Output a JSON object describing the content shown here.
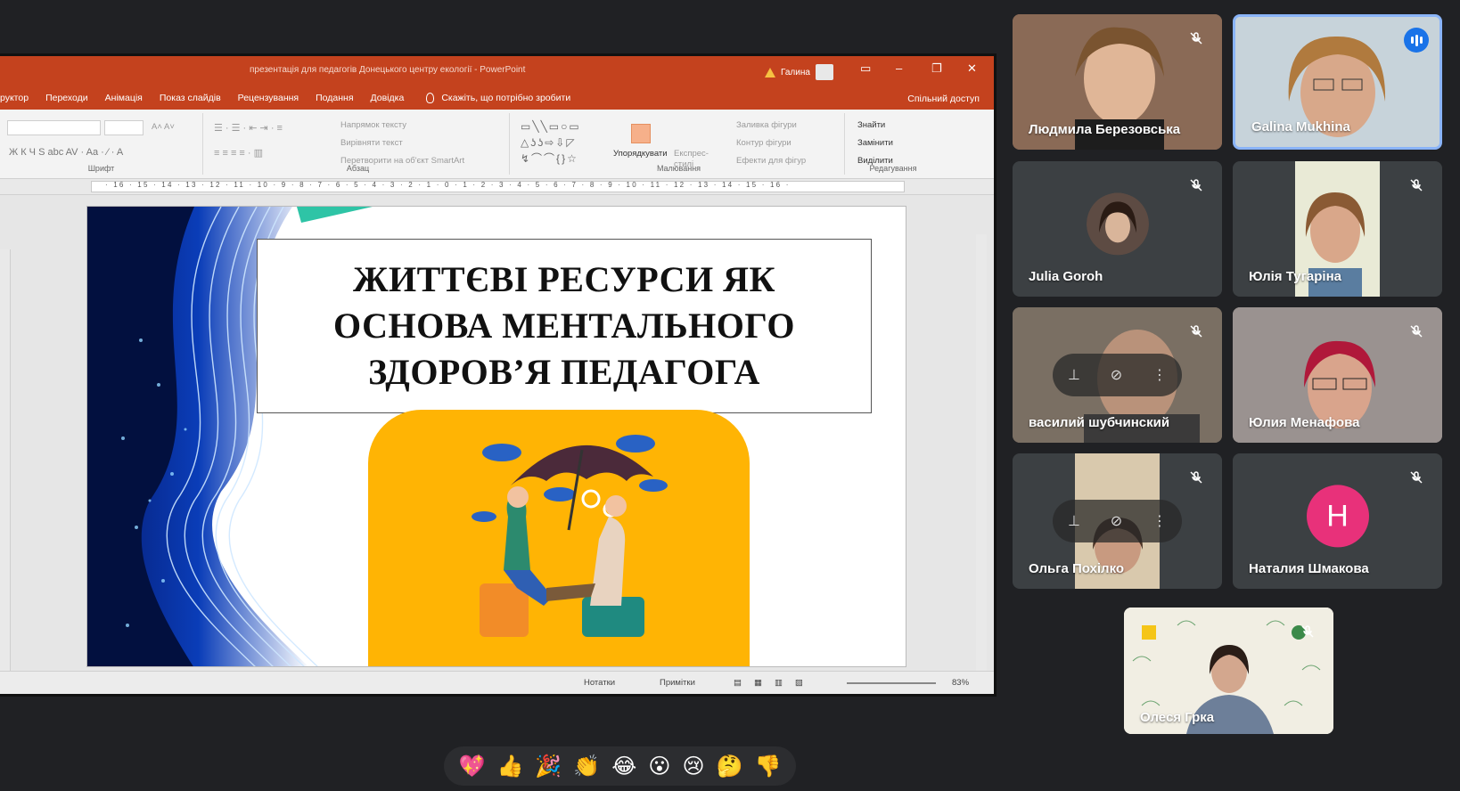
{
  "ppt": {
    "doc_title": "презентація для педагогів Донецького центру екології  -  PowerPoint",
    "user_name": "Галина",
    "tabs": [
      "руктор",
      "Переходи",
      "Анімація",
      "Показ слайдів",
      "Рецензування",
      "Подання",
      "Довідка"
    ],
    "tell_me": "Скажіть, що потрібно зробити",
    "share": "Спільний доступ",
    "ribbon": {
      "font_group": "Шрифт",
      "paragraph_group": "Абзац",
      "drawing_group": "Малювання",
      "editing_group": "Редагування",
      "text_direction": "Напрямок тексту",
      "align_text": "Вирівняти текст",
      "smartart": "Перетворити на об'єкт SmartArt",
      "arrange": "Упорядкувати",
      "quick_styles": "Експрес-стилі",
      "shape_fill": "Заливка фігури",
      "shape_outline": "Контур фігури",
      "shape_effects": "Ефекти для фігур",
      "find": "Знайти",
      "replace": "Замінити",
      "select": "Виділити"
    },
    "ruler_ticks": "· 16 · 15 · 14 · 13 · 12 · 11 · 10 · 9 · 8 · 7 · 6 · 5 · 4 · 3 · 2 · 1 · 0 · 1 · 2 · 3 · 4 · 5 · 6 · 7 · 8 · 9 · 10 · 11 · 12 · 13 · 14 · 15 · 16 ·",
    "slide": {
      "title_line1": "ЖИТТЄВІ РЕСУРСИ ЯК",
      "title_line2": "ОСНОВА МЕНТАЛЬНОГО",
      "title_line3": "ЗДОРОВ’Я ПЕДАГОГА"
    },
    "status": {
      "notes": "Нотатки",
      "comments": "Примітки",
      "zoom": "83%"
    }
  },
  "participants": [
    {
      "name": "Людмила Березовська",
      "muted": true
    },
    {
      "name": "Galina Mukhina",
      "speaking": true
    },
    {
      "name": "Julia Goroh",
      "muted": true
    },
    {
      "name": "Юлія Тугаріна",
      "muted": true
    },
    {
      "name": "василий шубчинский",
      "muted": true
    },
    {
      "name": "Юлия Менафова",
      "muted": true
    },
    {
      "name": "Ольга Похілко",
      "muted": true
    },
    {
      "name": "Наталия Шмакова",
      "muted": true,
      "initial": "Н",
      "avatar_color": "#e8317a"
    },
    {
      "name": "Олеся Грка",
      "muted": true
    }
  ],
  "reactions": [
    "💖",
    "👍",
    "🎉",
    "👏",
    "😂",
    "😮",
    "😢",
    "🤔",
    "👎"
  ]
}
